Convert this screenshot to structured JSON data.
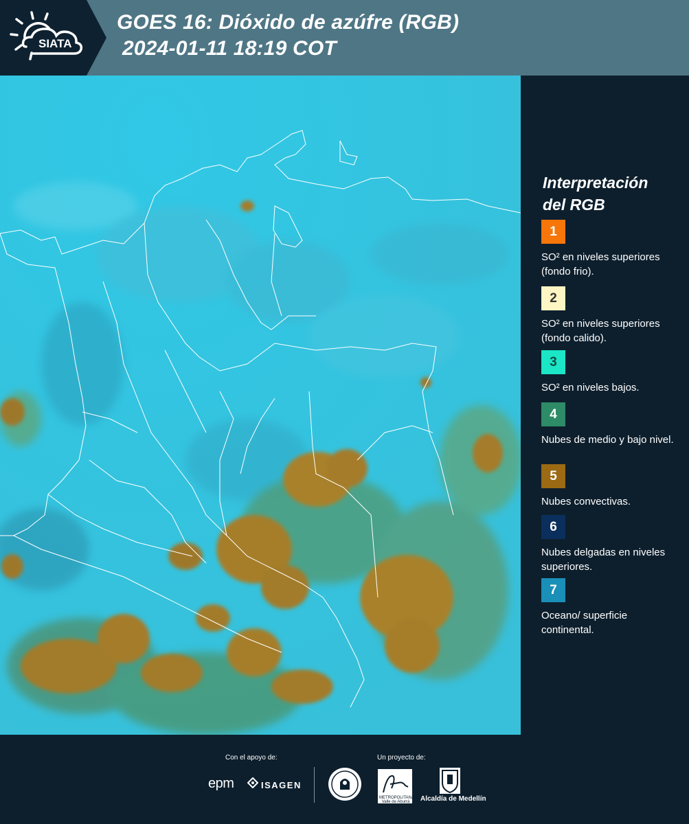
{
  "header": {
    "logo_text": "SIATA",
    "title_line1": "GOES 16: Dióxido de azúfre (RGB)",
    "title_line2": "2024-01-11 18:19 COT"
  },
  "legend": {
    "title_line1": "Interpretación",
    "title_line2": "del RGB",
    "items": [
      {
        "number": "1",
        "label": "SO² en niveles superiores (fondo frio).",
        "color": "#f7760a",
        "text_color": "#ffffff"
      },
      {
        "number": "2",
        "label": "SO² en niveles superiores (fondo calido).",
        "color": "#fdf5c3",
        "text_color": "#333333"
      },
      {
        "number": "3",
        "label": "SO² en niveles bajos.",
        "color": "#1be6c6",
        "text_color": "#0d4d44"
      },
      {
        "number": "4",
        "label": "Nubes de medio y bajo nivel.",
        "color": "#2e8b67",
        "text_color": "#ffffff"
      },
      {
        "number": "5",
        "label": "Nubes convectivas.",
        "color": "#9c6a12",
        "text_color": "#ffffff"
      },
      {
        "number": "6",
        "label": "Nubes delgadas en niveles superiores.",
        "color": "#0b2f5c",
        "text_color": "#ffffff"
      },
      {
        "number": "7",
        "label": "Oceano/ superficie continental.",
        "color": "#1a8fb8",
        "text_color": "#ffffff"
      }
    ]
  },
  "footer": {
    "support_label": "Con el apoyo de:",
    "project_label": "Un proyecto de:",
    "sponsor_1": "epm",
    "sponsor_2": "ISAGEN",
    "partner_area": "METROPOLITANA Valle de Aburrá",
    "partner_alcaldia": "Alcaldía de Medellín"
  },
  "map_colors": {
    "ocean": "#33c5e3",
    "land": "#3ab7d4",
    "convective": "#a37d2a",
    "mid_low": "#4e9b7a",
    "boundary": "#ffffff"
  }
}
